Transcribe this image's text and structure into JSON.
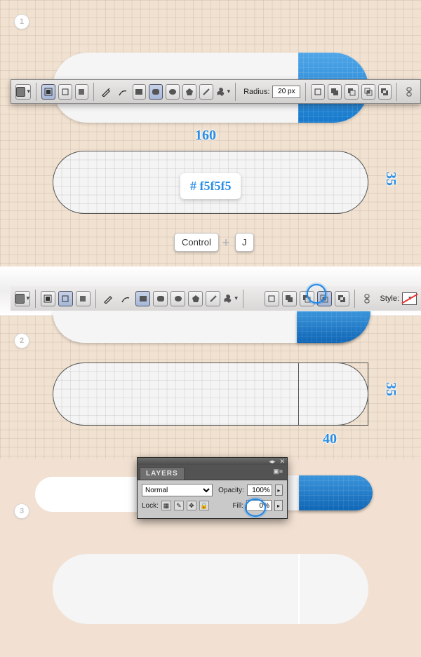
{
  "steps": {
    "s1": "1",
    "s2": "2",
    "s3": "3"
  },
  "toolbar1": {
    "radius_label": "Radius:",
    "radius_value": "20 px"
  },
  "toolbar2": {
    "style_label": "Style:"
  },
  "annotations": {
    "width_160": "160",
    "height_35a": "35",
    "height_35b": "35",
    "width_40": "40",
    "color_hex": "# f5f5f5"
  },
  "keys": {
    "control": "Control",
    "j": "J",
    "plus": "+"
  },
  "layers_panel": {
    "title": "LAYERS",
    "blend_mode": "Normal",
    "opacity_label": "Opacity:",
    "opacity_value": "100%",
    "lock_label": "Lock:",
    "fill_label": "Fill:",
    "fill_value": "0%",
    "menu_glyph": "▣≡",
    "close_glyph": "✕",
    "collapse_glyph": "◂▸"
  }
}
